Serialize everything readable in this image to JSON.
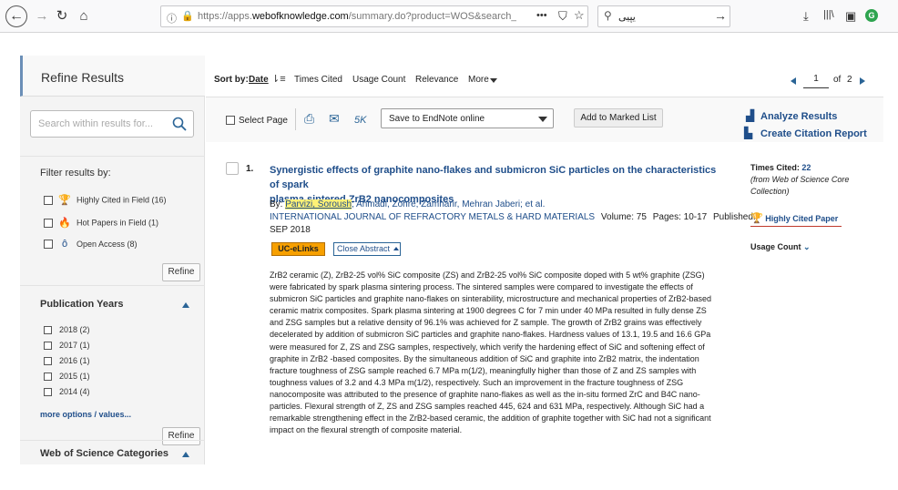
{
  "browser": {
    "url_prefix": "https://apps.",
    "url_domain": "webofknowledge.com",
    "url_suffix": "/summary.do?product=WOS&search_mode",
    "search_value": "یپیی",
    "menu_dots": "•••"
  },
  "refine": {
    "title": "Refine Results",
    "search_placeholder": "Search within results for...",
    "filter_title": "Filter results by:",
    "filters": [
      {
        "label": "Highly Cited in Field (16)",
        "icon": "trophy-icon"
      },
      {
        "label": "Hot Papers in Field (1)",
        "icon": "flame-icon"
      },
      {
        "label": "Open Access (8)",
        "icon": "open-lock-icon"
      }
    ],
    "refine_label": "Refine",
    "pub_years_title": "Publication Years",
    "years": [
      "2018 (2)",
      "2017 (1)",
      "2016 (1)",
      "2015 (1)",
      "2014 (4)"
    ],
    "more_options": "more options / values...",
    "wos_categories_title": "Web of Science Categories"
  },
  "sort": {
    "label": "Sort by:",
    "options": [
      "Date",
      "Times Cited",
      "Usage Count",
      "Relevance",
      "More"
    ],
    "page_current": "1",
    "page_of": "of",
    "page_total": "2"
  },
  "toolbar": {
    "select_page": "Select Page",
    "k5": "5K",
    "save_option": "Save to EndNote online",
    "add_marked": "Add to Marked List",
    "analyze": "Analyze Results",
    "citation_report": "Create Citation Report"
  },
  "record": {
    "number": "1.",
    "title_line1": "Synergistic effects of graphite nano-flakes and submicron SiC particles on the characteristics of spark",
    "title_line2": "plasma sintered ZrB2 nanocomposites",
    "by_label": "By:",
    "author_highlight": "Parvizi, Soroush",
    "authors_rest": "; Ahmadi, Zohre; Zamharir, Mehran Jaberi; et al.",
    "journal": "INTERNATIONAL JOURNAL OF REFRACTORY METALS & HARD MATERIALS",
    "volume": "Volume: 75",
    "pages": "Pages: 10-17",
    "published_label": "Published:",
    "published_date": "SEP 2018",
    "uc_elinks": "UC-eLinks",
    "close_abstract": "Close Abstract",
    "abstract": "ZrB2 ceramic (Z), ZrB2-25 vol% SiC composite (ZS) and ZrB2-25 vol% SiC composite doped with 5 wt% graphite (ZSG) were fabricated by spark plasma sintering process. The sintered samples were compared to investigate the effects of submicron SiC particles and graphite nano-flakes on sinterability, microstructure and mechanical properties of ZrB2-based ceramic matrix composites. Spark plasma sintering at 1900 degrees C for 7 min under 40 MPa resulted in fully dense ZS and ZSG samples but a relative density of 96.1% was achieved for Z sample. The growth of ZrB2 grains was effectively decelerated by addition of submicron SiC particles and graphite nano-flakes. Hardness values of 13.1, 19.5 and 16.6 GPa were measured for Z, ZS and ZSG samples, respectively, which verify the hardening effect of SiC and softening effect of graphite in ZrB2 -based composites. By the simultaneous addition of SiC and graphite into ZrB2 matrix, the indentation fracture toughness of ZSG sample reached 6.7 MPa m(1/2), meaningfully higher than those of Z and ZS samples with toughness values of 3.2 and 4.3 MPa m(1/2), respectively. Such an improvement in the fracture toughness of ZSG nanocomposite was attributed to the presence of graphite nano-flakes as well as the in-situ formed ZrC and B4C nano-particles. Flexural strength of Z, ZS and ZSG samples reached 445, 624 and 631 MPa, respectively. Although SiC had a remarkable strengthening effect in the ZrB2-based ceramic, the addition of graphite together with SiC had not a significant impact on the flexural strength of composite material.",
    "times_cited_label": "Times Cited:",
    "times_cited_value": "22",
    "times_cited_source": "(from Web of Science Core Collection)",
    "highly_cited": "Highly Cited Paper",
    "usage_count": "Usage Count"
  },
  "colors": {
    "accent_blue": "#1f4e8a",
    "trophy": "#e8a317",
    "flame": "#c0392b",
    "highlight": "#fff176",
    "uc_orange": "#f7a000"
  }
}
